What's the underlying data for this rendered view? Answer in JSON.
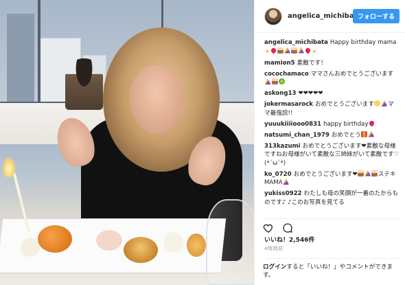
{
  "post": {
    "username": "angelica_michibata",
    "follow_label": "フォローする",
    "caption_user": "angelica_michibata",
    "caption_text": "Happy birthday mama",
    "caption_emojis": [
      "sparkle",
      "heart",
      "cake",
      "party",
      "cake",
      "party",
      "heart",
      "sparkle"
    ]
  },
  "comments": [
    {
      "user": "mamion5",
      "text": "素敵です！",
      "emojis": []
    },
    {
      "user": "cocochamaco",
      "text": "ママさんおめでとうございます",
      "emojis": [
        "party",
        "cake",
        "flower"
      ]
    },
    {
      "user": "askong13",
      "text": "❤❤❤❤❤",
      "emojis": []
    },
    {
      "user": "jokermasarock",
      "text": "おめでとうございます",
      "emojis": [
        "smile",
        "party"
      ],
      "text2": "ママ最強説!!"
    },
    {
      "user": "yuuukiiiiooo0831",
      "text": "happy birthday",
      "emojis": [
        "heart"
      ]
    },
    {
      "user": "natsumi_chan_1979",
      "text": "おめでとう",
      "emojis": [
        "gift",
        "party"
      ]
    },
    {
      "user": "313kazumi",
      "text": "おめでとうございます❤素敵な母様ですねお母様がいて素敵な三姉妹がいて素敵です♡ (*´ω`*)",
      "emojis": []
    },
    {
      "user": "ko_0720",
      "text": "おめでとうございます❤",
      "emojis": [
        "cake",
        "party",
        "cake"
      ],
      "text2": "ステキMAMA",
      "emojis2": [
        "party"
      ]
    },
    {
      "user": "yukiss0922",
      "text": "わたしも母の笑顔が一番のたからものです♪ ♪このお写真を見てる",
      "emojis": []
    }
  ],
  "stats": {
    "likes_label": "いいね！2,546件",
    "time_ago": "4時間前"
  },
  "login_prompt": {
    "link": "ログイン",
    "text": "すると「いいね！」やコメントができます。"
  },
  "colors": {
    "follow_button": "#3897f0",
    "heart": "#e0245e"
  },
  "icons": {
    "like": "heart-outline-icon",
    "comment": "speech-bubble-icon"
  }
}
